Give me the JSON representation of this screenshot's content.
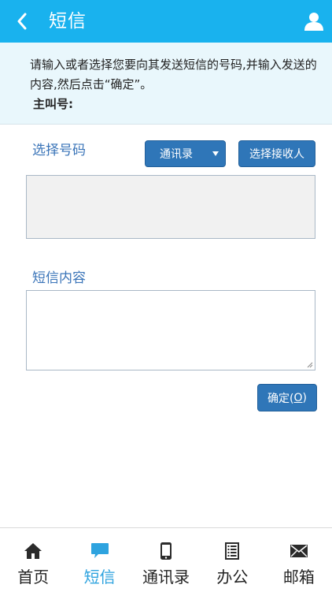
{
  "header": {
    "title": "短信"
  },
  "notice": {
    "text": "请输入或者选择您要向其发送短信的号码,并输入发送的内容,然后点击“确定”。",
    "caller_label": "主叫号:"
  },
  "form": {
    "select_number_label": "选择号码",
    "contacts_dropdown_value": "通讯录",
    "select_receiver_label": "选择接收人",
    "receivers_value": "",
    "content_label": "短信内容",
    "content_value": "",
    "ok_label": "确定(",
    "ok_accel": "O",
    "ok_label_end": ")"
  },
  "tabbar": {
    "items": [
      {
        "label": "首页",
        "icon": "home-icon"
      },
      {
        "label": "短信",
        "icon": "chat-bubble-icon"
      },
      {
        "label": "通讯录",
        "icon": "phone-icon"
      },
      {
        "label": "办公",
        "icon": "document-list-icon"
      },
      {
        "label": "邮箱",
        "icon": "mail-icon"
      }
    ],
    "active_index": 1
  },
  "colors": {
    "header": "#19b2ee",
    "notice_bg": "#e9f7fc",
    "button": "#2f76b8",
    "label_blue": "#3a74b8",
    "tab_active": "#2ea3df"
  }
}
